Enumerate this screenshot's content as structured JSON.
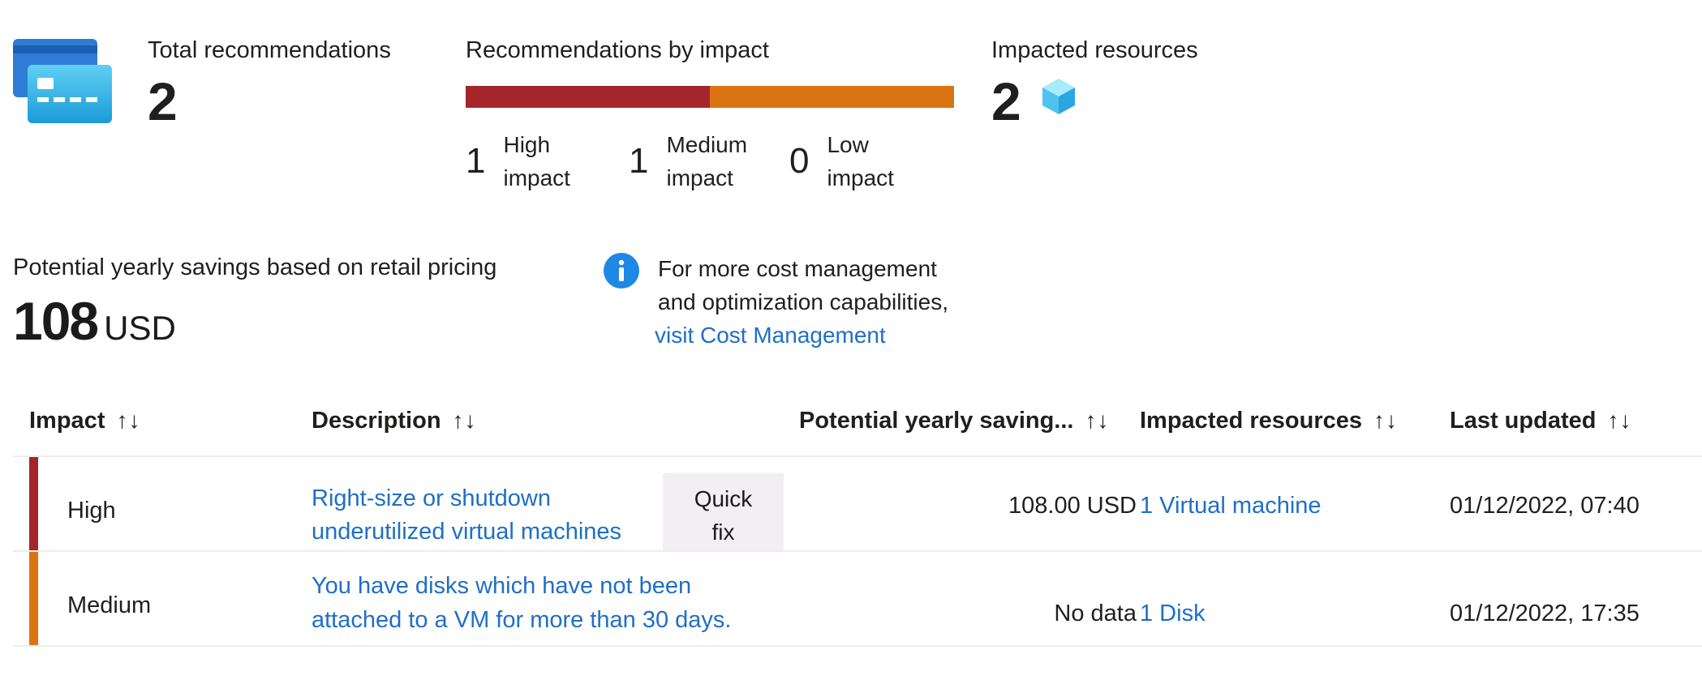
{
  "summary": {
    "total_label": "Total recommendations",
    "total_value": "2",
    "impact_label": "Recommendations by impact",
    "impact_counts": {
      "high_count": "1",
      "high_label": "High impact",
      "medium_count": "1",
      "medium_label": "Medium impact",
      "low_count": "0",
      "low_label": "Low impact"
    },
    "impact_bar_split": {
      "high_fraction": 0.5,
      "medium_fraction": 0.5,
      "low_fraction": 0
    },
    "impacted_label": "Impacted resources",
    "impacted_value": "2",
    "savings_label": "Potential yearly savings based on retail pricing",
    "savings_value": "108",
    "savings_currency": "USD",
    "info_text_line1": "For more cost management",
    "info_text_line2": "and optimization capabilities,",
    "info_link": "visit Cost Management"
  },
  "colors": {
    "high": "#a4262c",
    "medium": "#db7313",
    "link": "#1f6fc5",
    "info": "#1e88e5"
  },
  "table": {
    "headers": {
      "impact": "Impact",
      "description": "Description",
      "savings": "Potential yearly saving...",
      "resources": "Impacted resources",
      "updated": "Last updated"
    },
    "sort_glyph": "↑↓",
    "rows": [
      {
        "impact": "High",
        "description_line1": "Right-size or shutdown",
        "description_line2": "underutilized virtual machines",
        "quick_fix_line1": "Quick",
        "quick_fix_line2": "fix",
        "savings": "108.00 USD",
        "resources": "1 Virtual machine",
        "updated": "01/12/2022, 07:40"
      },
      {
        "impact": "Medium",
        "description_line1": "You have disks which have not been",
        "description_line2": "attached to a VM for more than 30 days.",
        "savings": "No data",
        "resources": "1 Disk",
        "updated": "01/12/2022, 17:35"
      }
    ]
  }
}
